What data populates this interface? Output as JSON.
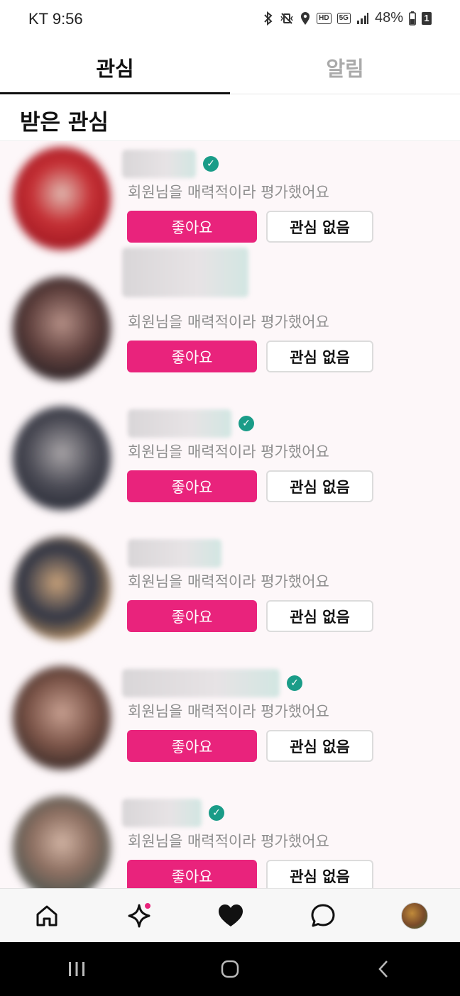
{
  "status_bar": {
    "carrier_time": "KT 9:56",
    "battery_percent": "48%",
    "battery_badge": "1",
    "hd_label": "HD",
    "network_label": "5G",
    "icons": [
      "bluetooth-icon",
      "vibrate-icon",
      "location-icon",
      "hd-call-icon",
      "5g-icon",
      "signal-icon",
      "battery-icon"
    ]
  },
  "tabs": [
    {
      "label": "관심",
      "active": true
    },
    {
      "label": "알림",
      "active": false
    }
  ],
  "section": {
    "title": "받은 관심"
  },
  "items": [
    {
      "description": "회원님을 매력적이라 평가했어요",
      "like_label": "좋아요",
      "no_interest_label": "관심 없음",
      "verified": true
    },
    {
      "description": "회원님을 매력적이라 평가했어요",
      "like_label": "좋아요",
      "no_interest_label": "관심 없음",
      "verified": false
    },
    {
      "description": "회원님을 매력적이라 평가했어요",
      "like_label": "좋아요",
      "no_interest_label": "관심 없음",
      "verified": true
    },
    {
      "description": "회원님을 매력적이라 평가했어요",
      "like_label": "좋아요",
      "no_interest_label": "관심 없음",
      "verified": false
    },
    {
      "description": "회원님을 매력적이라 평가했어요",
      "like_label": "좋아요",
      "no_interest_label": "관심 없음",
      "verified": true
    },
    {
      "description": "회원님을 매력적이라 평가했어요",
      "like_label": "좋아요",
      "no_interest_label": "관심 없음",
      "verified": true
    }
  ],
  "bottom_nav": [
    {
      "icon": "home-icon"
    },
    {
      "icon": "sparkle-icon",
      "badge": true
    },
    {
      "icon": "heart-icon"
    },
    {
      "icon": "chat-bubble-icon"
    },
    {
      "icon": "profile-avatar"
    }
  ],
  "colors": {
    "accent": "#e9237c",
    "verified": "#1a9c88",
    "list_background": "#fdf7f9"
  }
}
